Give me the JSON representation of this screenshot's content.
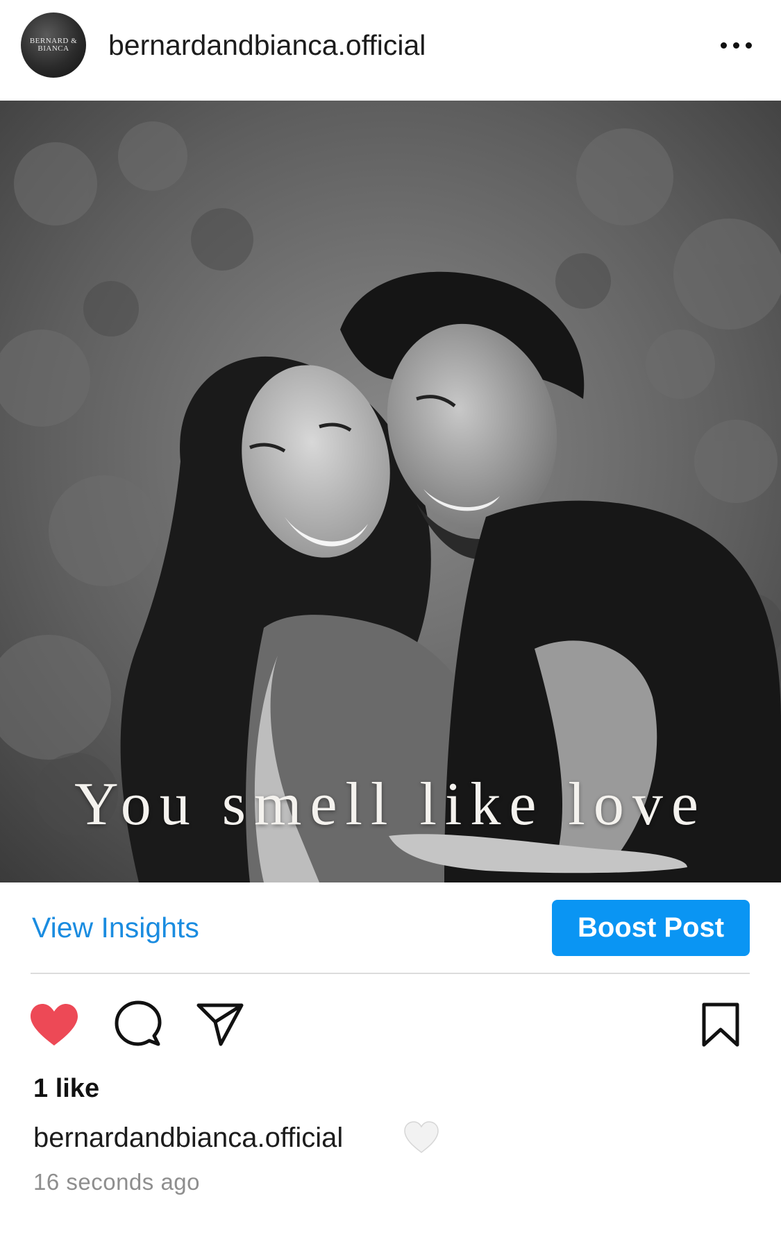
{
  "header": {
    "username": "bernardandbianca.official",
    "avatar_monogram": "BERNARD & BIANCA"
  },
  "post": {
    "overlay_text": "You smell like love",
    "photo_description_icon": "couple-photo"
  },
  "insights": {
    "view_insights_label": "View Insights",
    "boost_label": "Boost Post"
  },
  "actions": {
    "like_icon": "heart-filled-icon",
    "comment_icon": "comment-icon",
    "share_icon": "paper-plane-icon",
    "save_icon": "bookmark-icon"
  },
  "footer": {
    "likes_text": "1 like",
    "caption_username": "bernardandbianca.official",
    "caption_emoji": "🤍",
    "timestamp": "16 seconds ago"
  },
  "colors": {
    "link_blue": "#1a8ce0",
    "button_blue": "#0a95f3",
    "like_red": "#ed4956",
    "muted_gray": "#8e8e8e"
  }
}
